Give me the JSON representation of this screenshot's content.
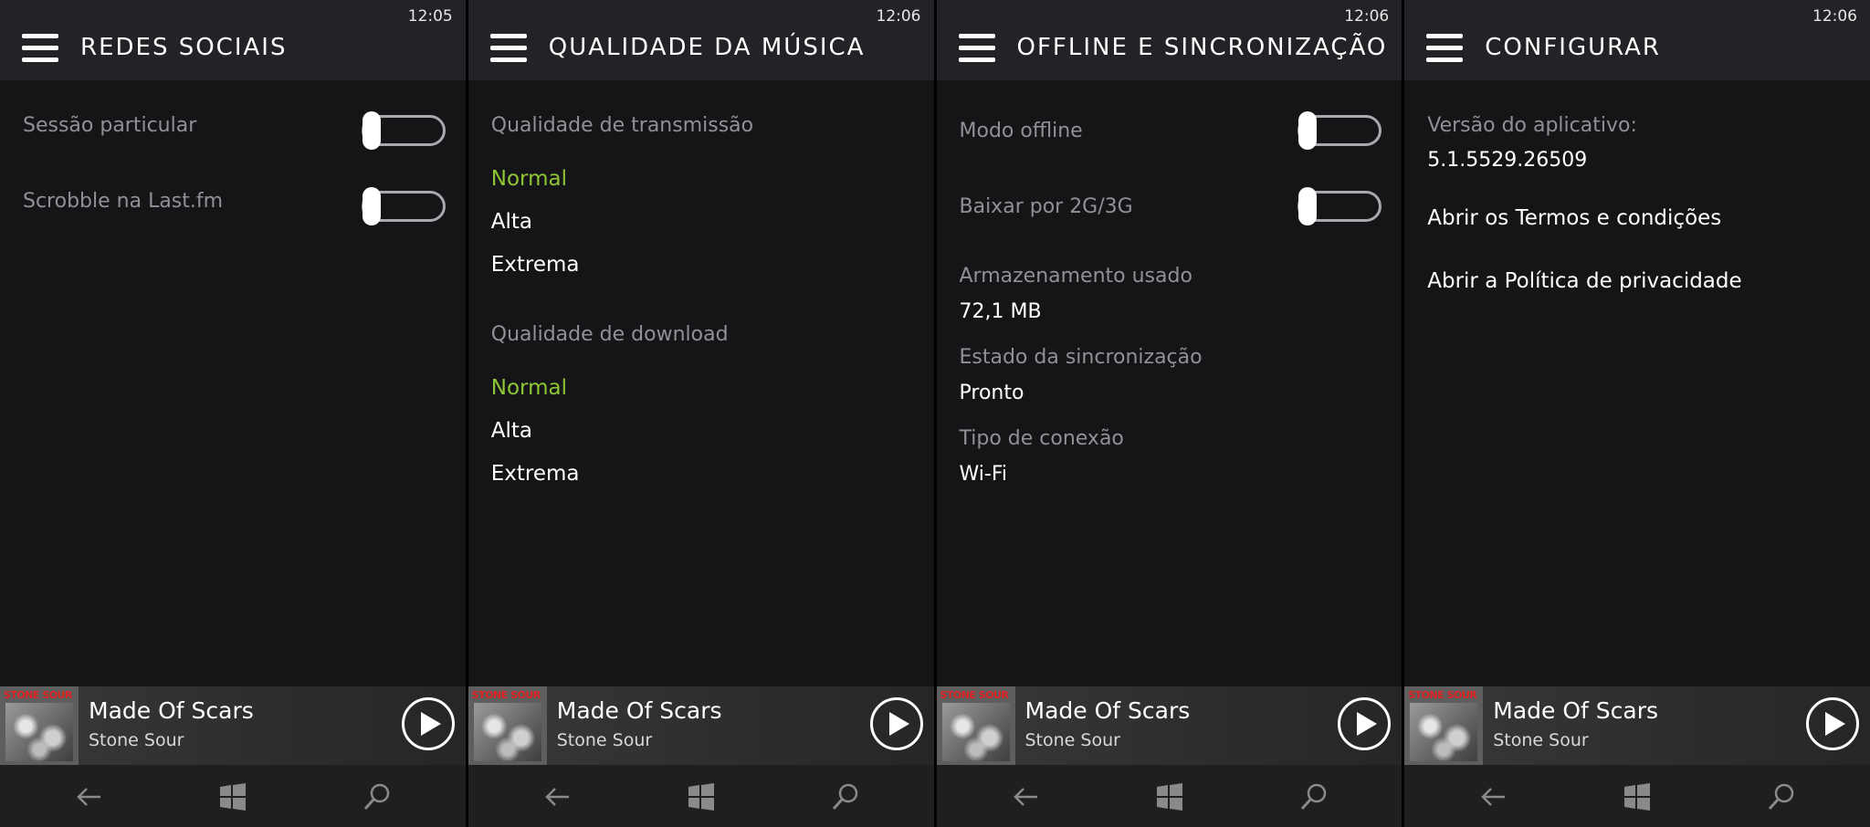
{
  "screens": [
    {
      "clock": "12:05",
      "title": "REDES SOCIAIS",
      "toggles": [
        {
          "label": "Sessão particular",
          "on": false
        },
        {
          "label": "Scrobble na Last.fm",
          "on": false
        }
      ]
    },
    {
      "clock": "12:06",
      "title": "QUALIDADE DA MÚSICA",
      "streaming": {
        "label": "Qualidade de transmissão",
        "options": [
          "Normal",
          "Alta",
          "Extrema"
        ],
        "selected": "Normal"
      },
      "download": {
        "label": "Qualidade de download",
        "options": [
          "Normal",
          "Alta",
          "Extrema"
        ],
        "selected": "Normal"
      }
    },
    {
      "clock": "12:06",
      "title": "OFFLINE E SINCRONIZAÇÃO",
      "toggles": [
        {
          "label": "Modo offline",
          "on": false
        },
        {
          "label": "Baixar por 2G/3G",
          "on": false
        }
      ],
      "info": [
        {
          "label": "Armazenamento usado",
          "value": "72,1 MB"
        },
        {
          "label": "Estado da sincronização",
          "value": "Pronto"
        },
        {
          "label": "Tipo de conexão",
          "value": "Wi-Fi"
        }
      ]
    },
    {
      "clock": "12:06",
      "title": "CONFIGURAR",
      "version_label": "Versão do aplicativo:",
      "version_value": "5.1.5529.26509",
      "links": [
        "Abrir os Termos e condições",
        "Abrir a Política de privacidade"
      ]
    }
  ],
  "player": {
    "track": "Made Of Scars",
    "artist": "Stone Sour",
    "album_text": "STONE SOUR"
  },
  "colors": {
    "accent": "#8fc636",
    "background": "#151517",
    "header": "#222326"
  },
  "icons": [
    "hamburger-menu-icon",
    "play-icon",
    "back-arrow-icon",
    "windows-logo-icon",
    "search-icon"
  ]
}
